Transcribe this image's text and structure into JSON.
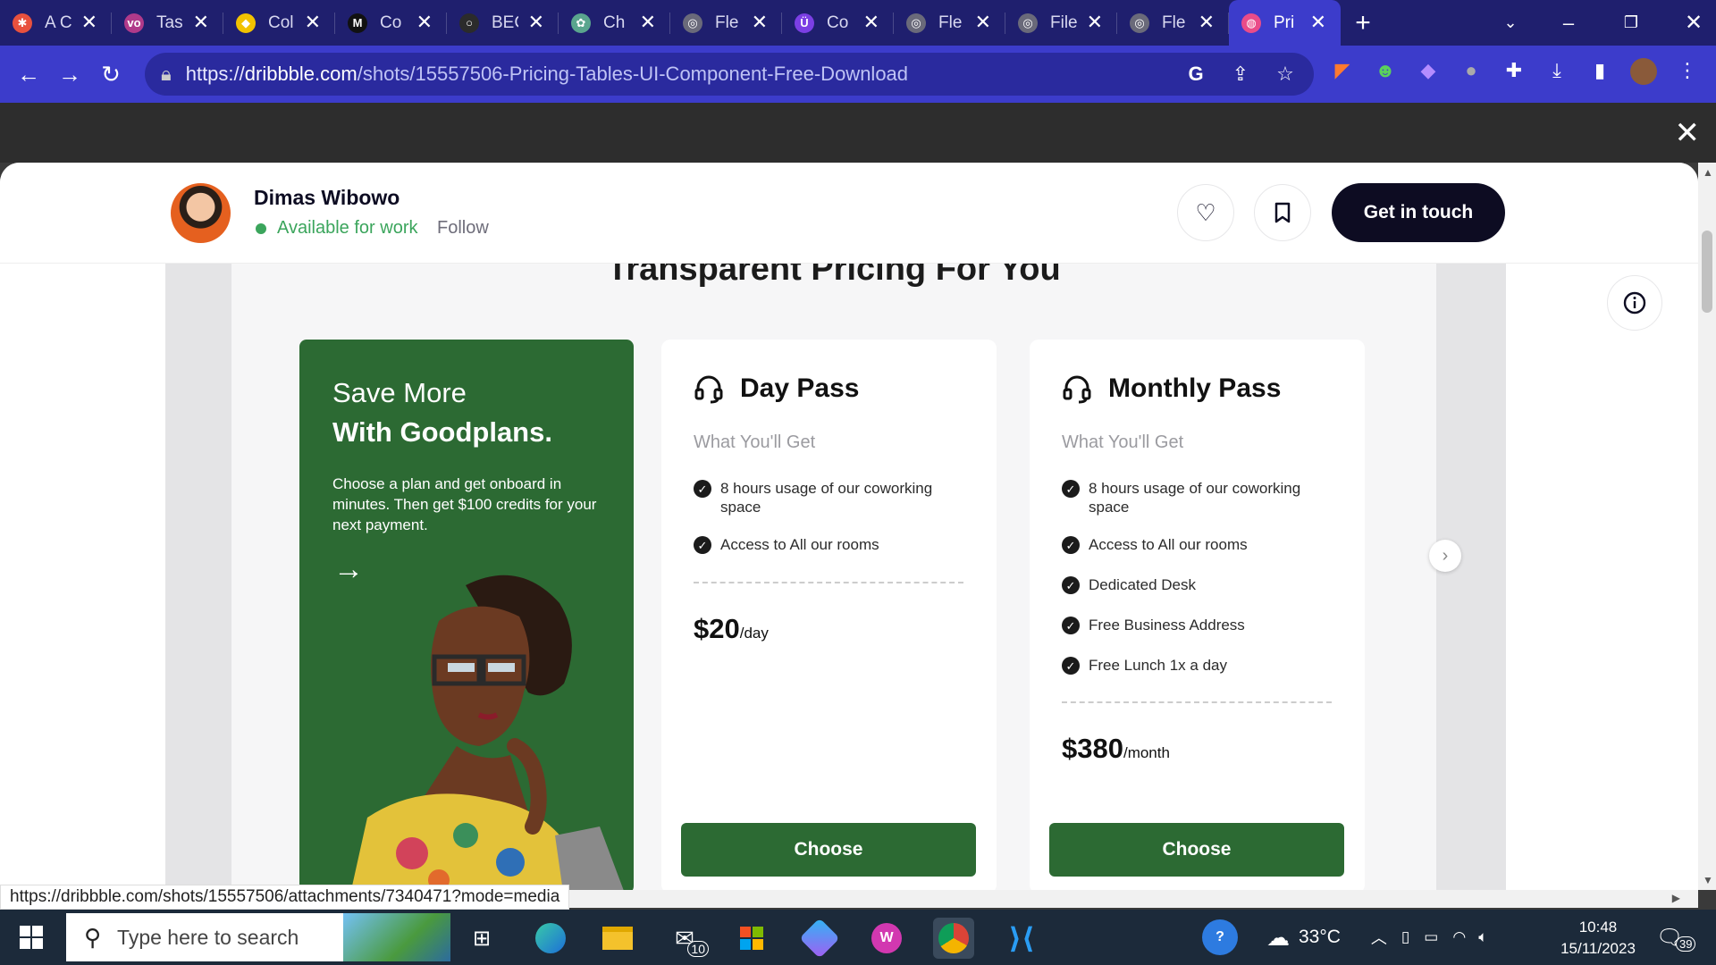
{
  "browser": {
    "tabs": [
      {
        "title": "A C",
        "favicon_color": "#e8513e",
        "favicon_glyph": "✱"
      },
      {
        "title": "Tas",
        "favicon_color": "#b03a8a",
        "favicon_glyph": "vo"
      },
      {
        "title": "Col",
        "favicon_color": "#f2c200",
        "favicon_glyph": "◆"
      },
      {
        "title": "Co",
        "favicon_color": "#111111",
        "favicon_glyph": "M"
      },
      {
        "title": "BEC",
        "favicon_color": "#2b2b2b",
        "favicon_glyph": "○"
      },
      {
        "title": "Ch",
        "favicon_color": "#5aa58e",
        "favicon_glyph": "✿"
      },
      {
        "title": "Fle",
        "favicon_color": "#6a6a7a",
        "favicon_glyph": "◎"
      },
      {
        "title": "Co",
        "favicon_color": "#7b3fe4",
        "favicon_glyph": "Ü"
      },
      {
        "title": "Fle",
        "favicon_color": "#6a6a7a",
        "favicon_glyph": "◎"
      },
      {
        "title": "File",
        "favicon_color": "#6a6a7a",
        "favicon_glyph": "◎"
      },
      {
        "title": "Fle",
        "favicon_color": "#6a6a7a",
        "favicon_glyph": "◎"
      },
      {
        "title": "Pri",
        "favicon_color": "#ea4c89",
        "favicon_glyph": "◍",
        "active": true
      }
    ],
    "url_prefix": "https://",
    "url_host": "dribbble.com",
    "url_path": "/shots/15557506-Pricing-Tables-UI-Component-Free-Download",
    "status_url": "https://dribbble.com/shots/15557506/attachments/7340471?mode=media"
  },
  "shot_header": {
    "author_name": "Dimas Wibowo",
    "availability": "Available for work",
    "follow_label": "Follow",
    "get_in_touch_label": "Get in touch"
  },
  "shot": {
    "title": "Transparent Pricing For You",
    "promo": {
      "line1": "Save More",
      "line2": "With Goodplans.",
      "description": "Choose a plan and get onboard in minutes. Then get $100 credits for your next payment."
    },
    "plans": [
      {
        "name": "Day Pass",
        "subtitle": "What You'll Get",
        "features": [
          "8 hours usage of our coworking space",
          "Access to All our rooms"
        ],
        "price": "$20",
        "period": "/day",
        "button": "Choose"
      },
      {
        "name": "Monthly Pass",
        "subtitle": "What You'll Get",
        "features": [
          "8 hours usage of our coworking space",
          "Access to All our rooms",
          "Dedicated Desk",
          "Free Business Address",
          "Free Lunch 1x a day"
        ],
        "price": "$380",
        "period": "/month",
        "button": "Choose"
      }
    ]
  },
  "taskbar": {
    "search_placeholder": "Type here to search",
    "mail_badge": "10",
    "weather": "33°C",
    "time": "10:48",
    "date": "15/11/2023",
    "notifications": "39"
  },
  "colors": {
    "tab_strip": "#1f1f6e",
    "toolbar": "#3c3ccb",
    "brand_green": "#2c6a33",
    "dribbble_dark": "#0d0c22",
    "available_green": "#3ba55c"
  }
}
